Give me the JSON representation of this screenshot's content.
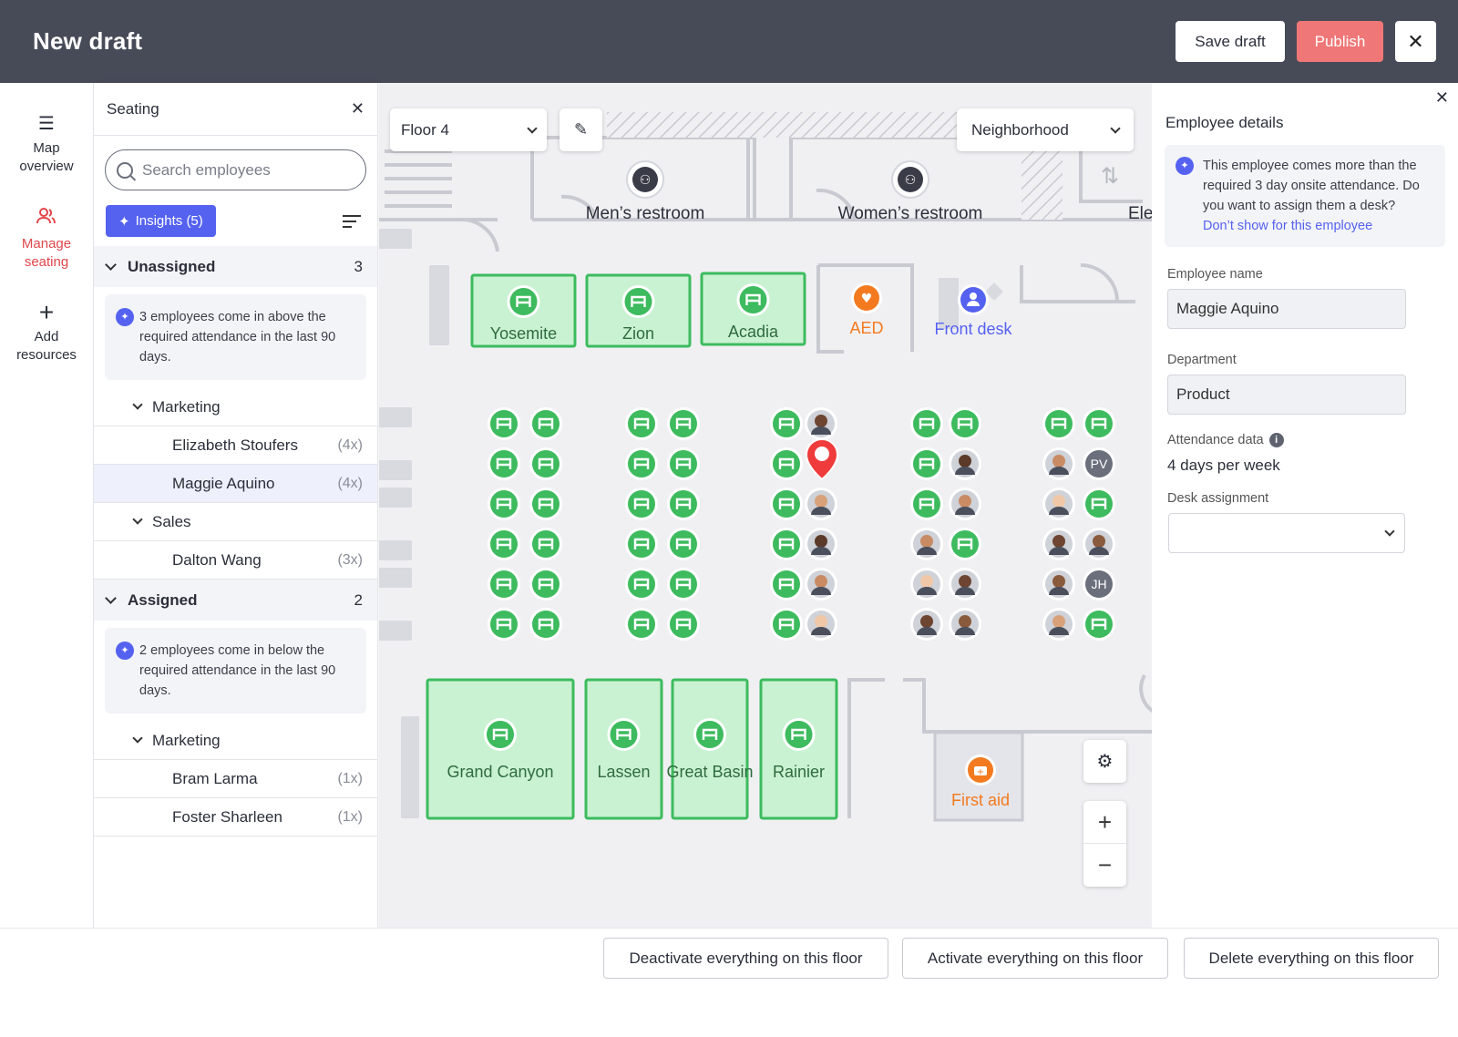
{
  "header": {
    "title": "New draft",
    "save_label": "Save draft",
    "publish_label": "Publish"
  },
  "rail": {
    "items": [
      {
        "label_1": "Map",
        "label_2": "overview",
        "icon": "menu-icon"
      },
      {
        "label_1": "Manage",
        "label_2": "seating",
        "icon": "people-icon"
      },
      {
        "label_1": "Add",
        "label_2": "resources",
        "icon": "plus-icon"
      }
    ]
  },
  "seating": {
    "title": "Seating",
    "search_placeholder": "Search employees",
    "insights_label": "Insights (5)",
    "unassigned": {
      "label": "Unassigned",
      "count": "3",
      "note": "3 employees come in above the required attendance in the last 90 days.",
      "groups": [
        {
          "name": "Marketing",
          "people": [
            {
              "name": "Elizabeth Stoufers",
              "n": "(4x)"
            },
            {
              "name": "Maggie Aquino",
              "n": "(4x)"
            }
          ]
        },
        {
          "name": "Sales",
          "people": [
            {
              "name": "Dalton Wang",
              "n": "(3x)"
            }
          ]
        }
      ]
    },
    "assigned": {
      "label": "Assigned",
      "count": "2",
      "note": "2 employees come in below the required attendance in the last 90 days.",
      "groups": [
        {
          "name": "Marketing",
          "people": [
            {
              "name": "Bram Larma",
              "n": "(1x)"
            },
            {
              "name": "Foster Sharleen",
              "n": "(1x)"
            }
          ]
        }
      ]
    }
  },
  "map": {
    "floor_label": "Floor 4",
    "neighborhood_label": "Neighborhood",
    "rooms_top": [
      "Men’s restroom",
      "Women’s restroom",
      "Ele"
    ],
    "meeting_rooms": [
      "Yosemite",
      "Zion",
      "Acadia"
    ],
    "poi": {
      "aed": "AED",
      "front_desk": "Front desk",
      "first_aid": "First aid"
    },
    "large_rooms": [
      "Grand Canyon",
      "Lassen",
      "Great Basin",
      "Rainier"
    ],
    "avatar_initials": [
      "PV",
      "JH"
    ],
    "colors": {
      "room_fill": "#c9f2d2",
      "room_stroke": "#3dbb5e",
      "desk": "#3dbb5e",
      "pin": "#ef3b3b",
      "aed": "#f37a1f",
      "front_desk": "#5562f0"
    }
  },
  "details": {
    "title": "Employee details",
    "note": "This employee comes more than the required 3 day onsite attendance. Do you want to assign them a desk?",
    "note_link": "Don’t show for this employee",
    "employee_name_label": "Employee name",
    "employee_name": "Maggie Aquino",
    "department_label": "Department",
    "department": "Product",
    "attendance_label": "Attendance data",
    "attendance_value": "4 days per week",
    "desk_label": "Desk assignment",
    "desk_value": ""
  },
  "footer": {
    "deactivate": "Deactivate everything on this floor",
    "activate": "Activate everything on this floor",
    "delete": "Delete everything on this floor"
  }
}
